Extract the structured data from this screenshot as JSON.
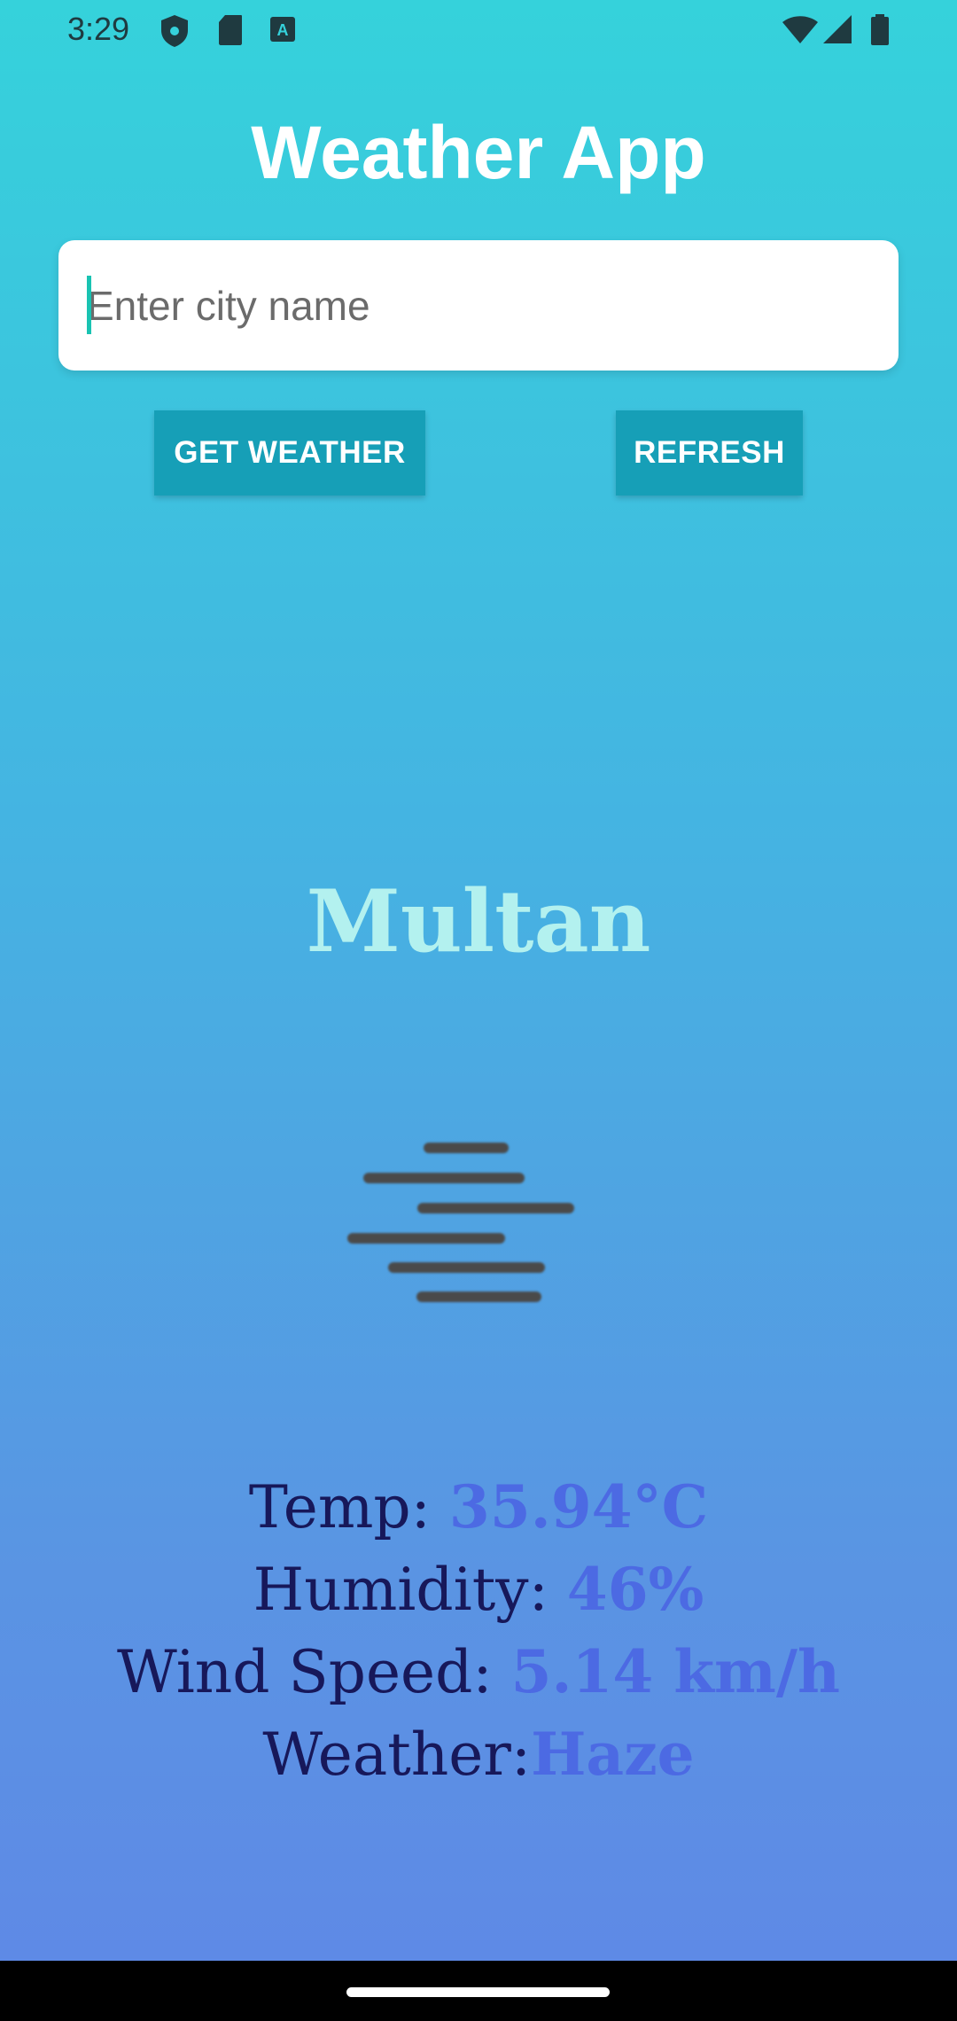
{
  "status_bar": {
    "time": "3:29",
    "left_icons": [
      "shield-icon",
      "sd-card-icon",
      "keyboard-a-icon"
    ],
    "right_icons": [
      "wifi-icon",
      "signal-icon",
      "battery-icon"
    ]
  },
  "app": {
    "title": "Weather App"
  },
  "search": {
    "value": "",
    "placeholder": "Enter city name"
  },
  "buttons": {
    "get_weather": "GET WEATHER",
    "refresh": "REFRESH"
  },
  "result": {
    "city": "Multan",
    "icon": "haze-icon",
    "temp_label": "Temp: ",
    "temp_value": "35.94°C",
    "humidity_label": "Humidity: ",
    "humidity_value": "46%",
    "wind_label": "Wind Speed: ",
    "wind_value": "5.14 km/h",
    "weather_label": "Weather:",
    "weather_value": "Haze"
  },
  "colors": {
    "gradient_top": "#35d2db",
    "gradient_bottom": "#5f88e6",
    "button": "#169fb7",
    "city_name": "#b3f1ef",
    "label_text": "#17185a",
    "value_text": "#4c6ae3"
  }
}
